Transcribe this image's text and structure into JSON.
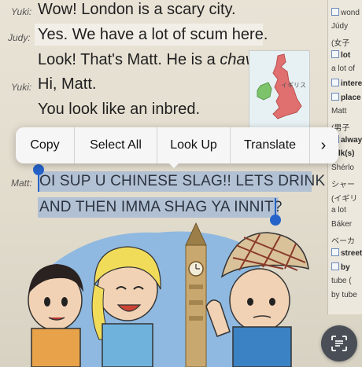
{
  "dialogue": {
    "speaker_yuki_1": "Yuki:",
    "line1": "Wow!  London is a scary city.",
    "speaker_judy": "Judy:",
    "line2": "Yes.  We have a lot of scum here.",
    "line3_prefix": "Look!  That's Matt.  He is a ",
    "line3_italic": "chav",
    "line3_suffix": ".",
    "speaker_yuki_2": "Yuki:",
    "line4": "Hi, Matt.",
    "line5": "You look like an inbred.",
    "speaker_matt": "Matt:",
    "selected_line1": "OI SUP U CHINESE SLAG!! LETS DRINK",
    "selected_line2": "AND THEN IMMA SHAG YA INNIT?"
  },
  "map_label": "イギリス",
  "vocab": [
    {
      "text": "wond",
      "checked": true,
      "bold": false
    },
    {
      "text": "Júdy",
      "checked": false,
      "bold": false
    },
    {
      "text": "(女子",
      "checked": false,
      "bold": false
    },
    {
      "text": "lot",
      "checked": true,
      "bold": true
    },
    {
      "text": "a lot of",
      "checked": false,
      "bold": false
    },
    {
      "text": "intere",
      "checked": true,
      "bold": true
    },
    {
      "text": "place",
      "checked": true,
      "bold": true
    },
    {
      "text": "Matt",
      "checked": false,
      "bold": false
    },
    {
      "text": "(男子",
      "checked": false,
      "bold": false
    },
    {
      "text": "alway",
      "checked": true,
      "bold": true
    },
    {
      "text": "talk(s)",
      "checked": false,
      "bold": true
    },
    {
      "text": "Shérlo",
      "checked": false,
      "bold": false
    },
    {
      "text": "シャー",
      "checked": false,
      "bold": false
    },
    {
      "text": "(イギリ",
      "checked": false,
      "bold": false
    },
    {
      "text": "a lot",
      "checked": false,
      "bold": false
    },
    {
      "text": "Báker",
      "checked": false,
      "bold": false
    },
    {
      "text": "ベーカ",
      "checked": false,
      "bold": false
    },
    {
      "text": "street",
      "checked": true,
      "bold": true
    },
    {
      "text": "by",
      "checked": true,
      "bold": true
    },
    {
      "text": "tube (",
      "checked": false,
      "bold": false
    },
    {
      "text": "by tube",
      "checked": false,
      "bold": false
    }
  ],
  "menu": {
    "copy": "Copy",
    "select_all": "Select All",
    "look_up": "Look Up",
    "translate": "Translate",
    "more": "›"
  },
  "colors": {
    "selection": "#78a0dc",
    "handle": "#2563c8",
    "menu_bg": "#f6f6f6",
    "live_text_button": "#4a4f57"
  }
}
